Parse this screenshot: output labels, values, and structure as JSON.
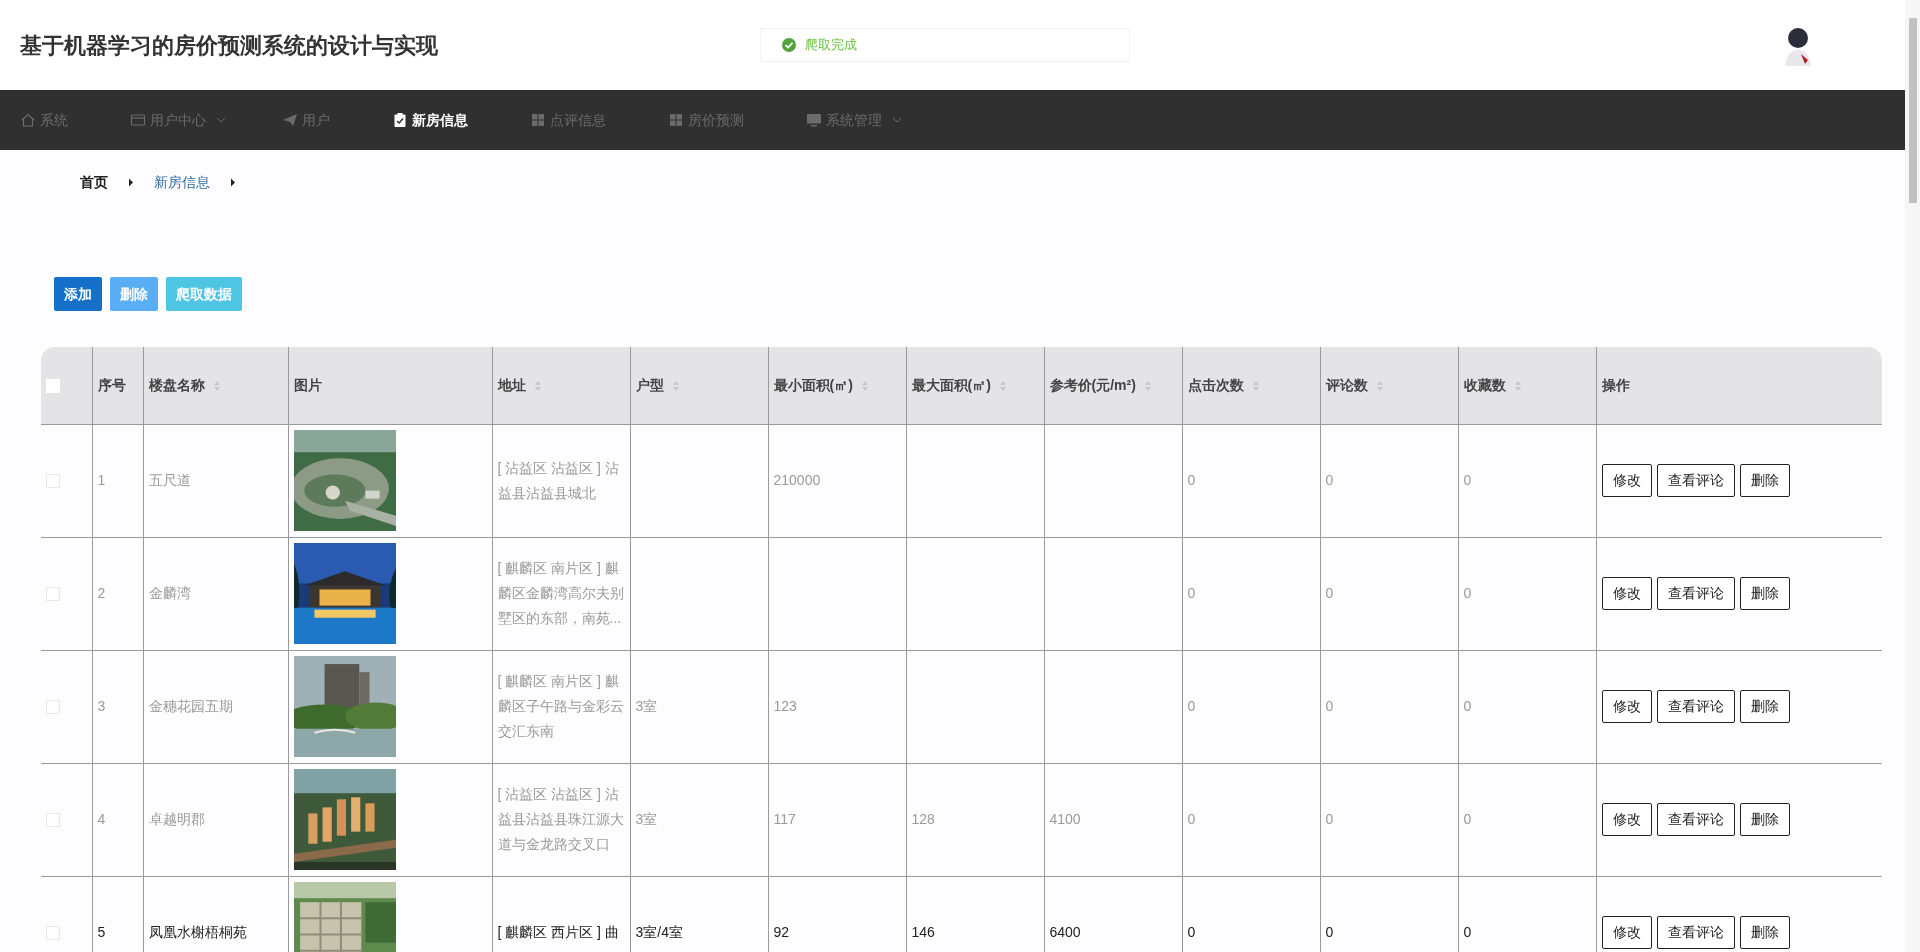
{
  "header": {
    "title": "基于机器学习的房价预测系统的设计与实现",
    "toast": {
      "text": "爬取完成"
    }
  },
  "nav": [
    {
      "label": "系统",
      "kind": "home",
      "selected": false,
      "dropdown": false
    },
    {
      "label": "用户中心",
      "kind": "card",
      "selected": false,
      "dropdown": true
    },
    {
      "label": "用户",
      "kind": "plane",
      "selected": false,
      "dropdown": false
    },
    {
      "label": "新房信息",
      "kind": "clipboard",
      "selected": true,
      "dropdown": false
    },
    {
      "label": "点评信息",
      "kind": "grid",
      "selected": false,
      "dropdown": false
    },
    {
      "label": "房价预测",
      "kind": "grid",
      "selected": false,
      "dropdown": false
    },
    {
      "label": "系统管理",
      "kind": "monitor",
      "selected": false,
      "dropdown": true
    }
  ],
  "breadcrumb": [
    {
      "label": "首页",
      "current": false
    },
    {
      "label": "新房信息",
      "current": true
    }
  ],
  "actions": [
    {
      "label": "添加",
      "kind": "primary"
    },
    {
      "label": "删除",
      "kind": "danger"
    },
    {
      "label": "爬取数据",
      "kind": "info"
    }
  ],
  "table": {
    "all_checked": false,
    "columns": [
      {
        "label": "序号",
        "sortable": false
      },
      {
        "label": "楼盘名称",
        "sortable": true
      },
      {
        "label": "图片",
        "sortable": false
      },
      {
        "label": "地址",
        "sortable": true
      },
      {
        "label": "户型",
        "sortable": true
      },
      {
        "label": "最小面积(㎡)",
        "sortable": true
      },
      {
        "label": "最大面积(㎡)",
        "sortable": true
      },
      {
        "label": "参考价(元/m²)",
        "sortable": true
      },
      {
        "label": "点击次数",
        "sortable": true
      },
      {
        "label": "评论数",
        "sortable": true
      },
      {
        "label": "收藏数",
        "sortable": true
      },
      {
        "label": "操作",
        "sortable": false
      }
    ],
    "rows": [
      {
        "highlighted": false,
        "checked": false,
        "cells": {
          "index": "1",
          "name": "五尺道",
          "address": "[ 沾益区 沾益区 ] 沾益县沾益县城北",
          "min_area": "210000",
          "clicks": "0",
          "comments": "0",
          "favorites": "0"
        },
        "buttons": [
          "修改",
          "查看评论",
          "删除"
        ]
      },
      {
        "highlighted": false,
        "checked": false,
        "cells": {
          "index": "2",
          "name": "金麟湾",
          "address": "[ 麒麟区 南片区 ] 麒麟区金麟湾高尔夫别墅区的东部，南苑...",
          "clicks": "0",
          "comments": "0",
          "favorites": "0"
        },
        "buttons": [
          "修改",
          "查看评论",
          "删除"
        ]
      },
      {
        "highlighted": false,
        "checked": false,
        "cells": {
          "index": "3",
          "name": "金穗花园五期",
          "address": "[ 麒麟区 南片区 ] 麒麟区子午路与金彩云交汇东南",
          "layout": "3室",
          "min_area": "123",
          "clicks": "0",
          "comments": "0",
          "favorites": "0"
        },
        "buttons": [
          "修改",
          "查看评论",
          "删除"
        ]
      },
      {
        "highlighted": false,
        "checked": false,
        "cells": {
          "index": "4",
          "name": "卓越明郡",
          "address": "[ 沾益区 沾益区 ] 沾益县沾益县珠江源大道与金龙路交叉口",
          "layout": "3室",
          "min_area": "117",
          "max_area": "128",
          "ref_price": "4100",
          "clicks": "0",
          "comments": "0",
          "favorites": "0"
        },
        "buttons": [
          "修改",
          "查看评论",
          "删除"
        ]
      },
      {
        "highlighted": true,
        "checked": false,
        "cells": {
          "index": "5",
          "name": "凤凰水榭梧桐苑",
          "address": "[ 麒麟区 西片区 ] 曲",
          "layout": "3室/4室",
          "min_area": "92",
          "max_area": "146",
          "ref_price": "6400",
          "clicks": "0",
          "comments": "0",
          "favorites": "0"
        },
        "buttons": [
          "修改",
          "查看评论",
          "删除"
        ]
      }
    ]
  }
}
